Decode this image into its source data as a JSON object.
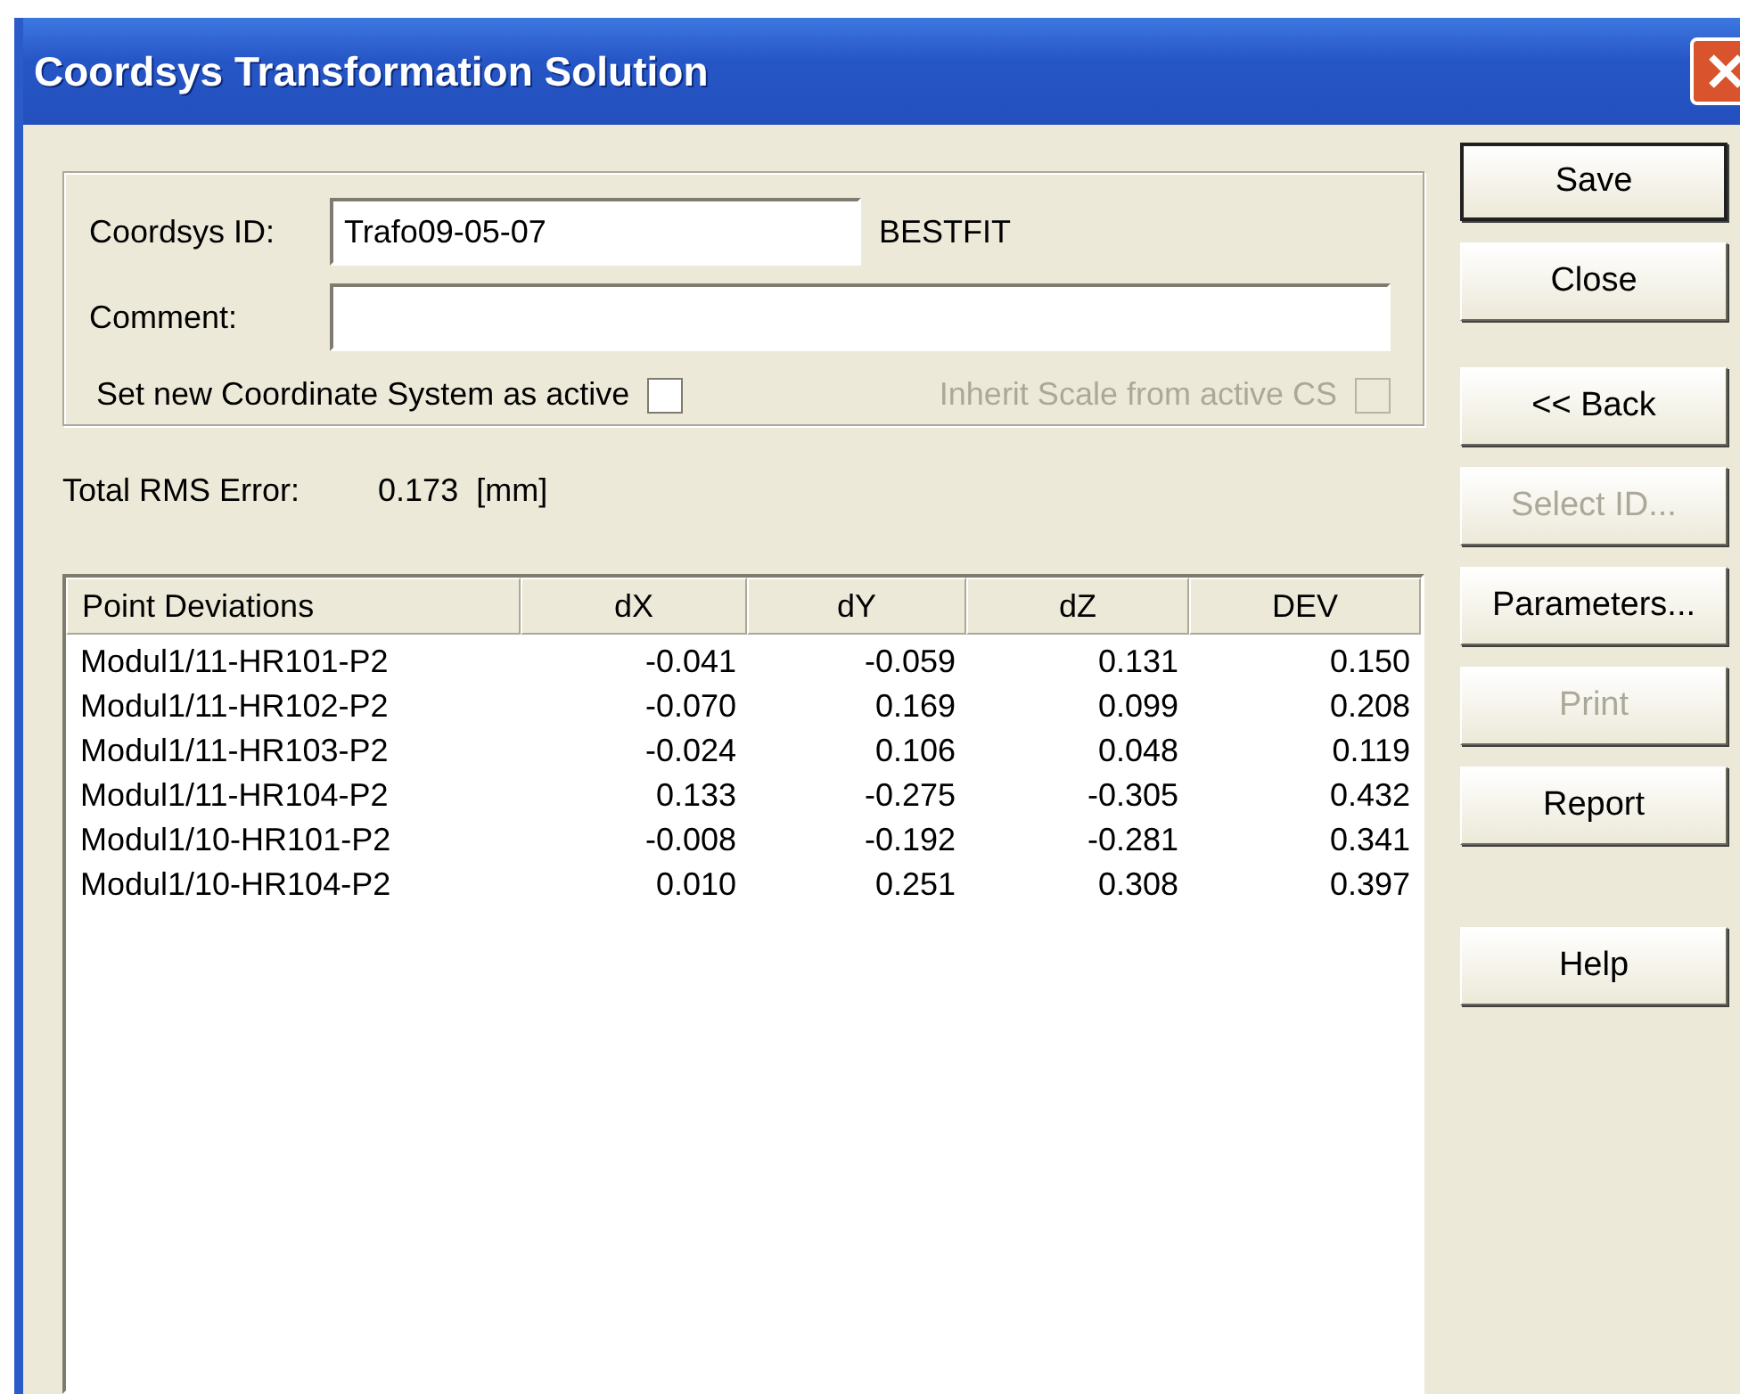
{
  "window": {
    "title": "Coordsys Transformation Solution"
  },
  "form": {
    "coordsys_id": {
      "label": "Coordsys ID:",
      "value": "Trafo09-05-07",
      "tag": "BESTFIT"
    },
    "comment": {
      "label": "Comment:"
    },
    "checkboxes": [
      {
        "label": "Set new Coordinate System as active",
        "checked": false,
        "disabled": false
      },
      {
        "label": "Inherit Scale from active CS",
        "checked": false,
        "disabled": true
      }
    ]
  },
  "rms": {
    "label": "Total RMS Error:",
    "value": "0.173  [mm]"
  },
  "table": {
    "columns": [
      "Point Deviations",
      "dX",
      "dY",
      "dZ",
      "DEV"
    ],
    "rows": [
      [
        "Modul1/11-HR101-P2",
        "-0.041",
        "-0.059",
        "0.131",
        "0.150"
      ],
      [
        "Modul1/11-HR102-P2",
        "-0.070",
        "0.169",
        "0.099",
        "0.208"
      ],
      [
        "Modul1/11-HR103-P2",
        "-0.024",
        "0.106",
        "0.048",
        "0.119"
      ],
      [
        "Modul1/11-HR104-P2",
        "0.133",
        "-0.275",
        "-0.305",
        "0.432"
      ],
      [
        "Modul1/10-HR101-P2",
        "-0.008",
        "-0.192",
        "-0.281",
        "0.341"
      ],
      [
        "Modul1/10-HR104-P2",
        "0.010",
        "0.251",
        "0.308",
        "0.397"
      ]
    ]
  },
  "button_groups": [
    [
      {
        "label": "Save",
        "disabled": false,
        "default": true
      },
      {
        "label": "Close",
        "disabled": false,
        "default": false
      }
    ],
    [
      {
        "label": "<< Back",
        "disabled": false,
        "default": false
      },
      {
        "label": "Select ID...",
        "disabled": true,
        "default": false
      },
      {
        "label": "Parameters...",
        "disabled": false,
        "default": false
      },
      {
        "label": "Print",
        "disabled": true,
        "default": false
      },
      {
        "label": "Report",
        "disabled": false,
        "default": false
      }
    ],
    [
      {
        "label": "Help",
        "disabled": false,
        "default": false
      }
    ]
  ]
}
